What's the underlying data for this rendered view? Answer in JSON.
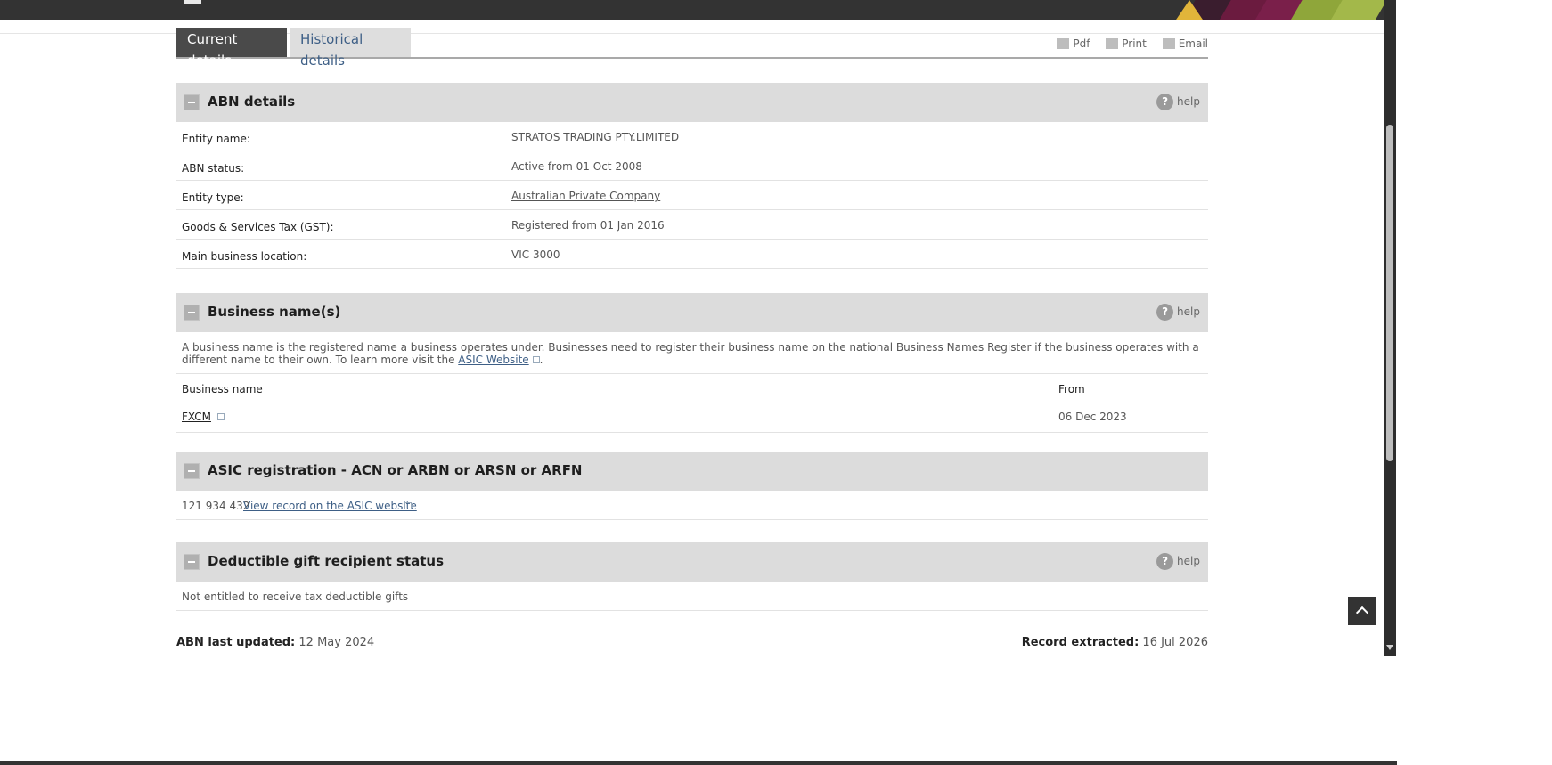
{
  "tabs": {
    "current": "Current details",
    "historical": "Historical details"
  },
  "tools": {
    "pdf": "Pdf",
    "print": "Print",
    "email": "Email"
  },
  "help_label": "help",
  "abn_details": {
    "title": "ABN details",
    "rows": [
      {
        "label": "Entity name:",
        "value": "STRATOS TRADING PTY.LIMITED"
      },
      {
        "label": "ABN status:",
        "value": "Active from 01 Oct 2008"
      },
      {
        "label": "Entity type:",
        "value": "Australian Private Company"
      },
      {
        "label": "Goods & Services Tax (GST):",
        "value": "Registered from 01 Jan 2016"
      },
      {
        "label": "Main business location:",
        "value": "VIC 3000"
      }
    ]
  },
  "business_names": {
    "title": "Business name(s)",
    "desc_prefix": "A business name is the registered name a business operates under. Businesses need to register their business name on the national Business Names Register if the business operates with a different name to their own. To learn more visit the ",
    "desc_link": "ASIC Website",
    "desc_suffix": ".",
    "col_name": "Business name",
    "col_from": "From",
    "items": [
      {
        "name": "FXCM",
        "from": "06 Dec 2023"
      }
    ]
  },
  "asic": {
    "title": "ASIC registration - ACN or ARBN or ARSN or ARFN",
    "number": "121 934 432",
    "link": "View record on the ASIC website"
  },
  "dgr": {
    "title": "Deductible gift recipient status",
    "text": "Not entitled to receive tax deductible gifts"
  },
  "footer": {
    "updated_label": "ABN last updated:",
    "updated_value": "12 May 2024",
    "extracted_label": "Record extracted:",
    "extracted_value": "16 Jul 2026"
  },
  "colors": {
    "accent": "#3e5f86",
    "header": "#333333",
    "section": "#dcdcdc"
  }
}
